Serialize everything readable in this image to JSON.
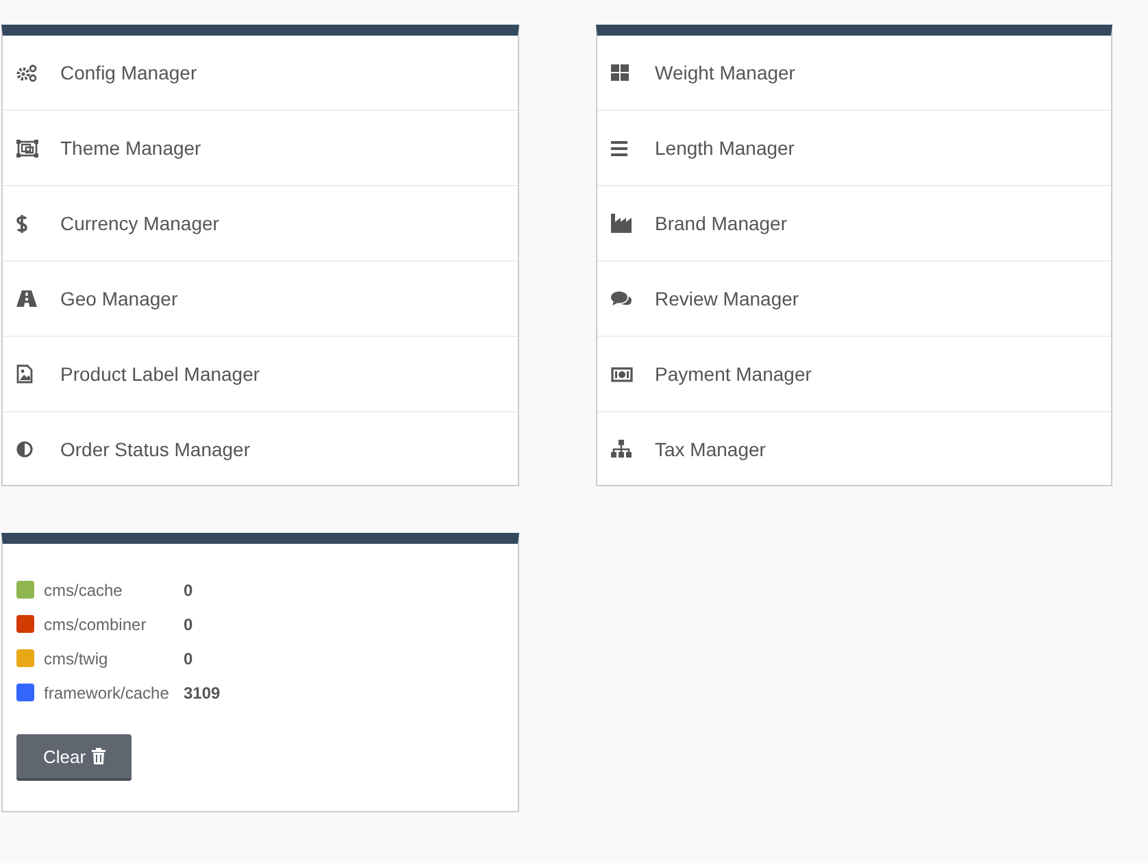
{
  "left_panel": {
    "items": [
      {
        "label": "Config Manager"
      },
      {
        "label": "Theme Manager"
      },
      {
        "label": "Currency Manager"
      },
      {
        "label": "Geo Manager"
      },
      {
        "label": "Product Label Manager"
      },
      {
        "label": "Order Status Manager"
      }
    ]
  },
  "right_panel": {
    "items": [
      {
        "label": "Weight Manager"
      },
      {
        "label": "Length Manager"
      },
      {
        "label": "Brand Manager"
      },
      {
        "label": "Review Manager"
      },
      {
        "label": "Payment Manager"
      },
      {
        "label": "Tax Manager"
      }
    ]
  },
  "cache_panel": {
    "items": [
      {
        "label": "cms/cache",
        "count": "0",
        "color": "#8fb650"
      },
      {
        "label": "cms/combiner",
        "count": "0",
        "color": "#d13b00"
      },
      {
        "label": "cms/twig",
        "count": "0",
        "color": "#e8a816"
      },
      {
        "label": "framework/cache",
        "count": "3109",
        "color": "#3366ff"
      }
    ],
    "clear_button": "Clear"
  }
}
